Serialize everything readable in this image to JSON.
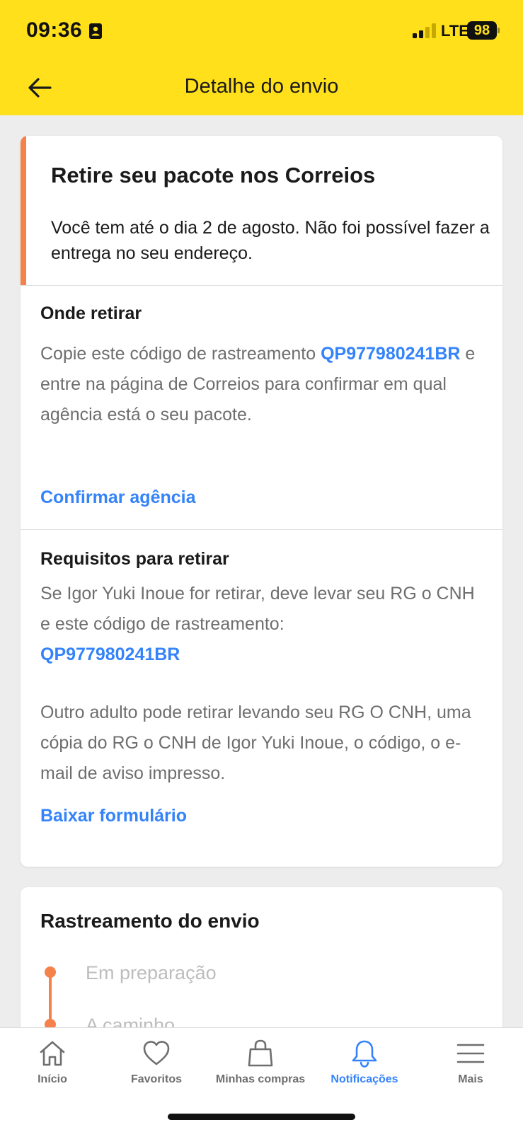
{
  "status_bar": {
    "time": "09:36",
    "network": "LTE",
    "battery": "98"
  },
  "header": {
    "title": "Detalhe do envio",
    "back_icon": "arrow-left-icon",
    "background": "#ffe01b"
  },
  "alert": {
    "title": "Retire seu pacote nos Correios",
    "text": "Você tem até o dia 2 de agosto. Não foi possível fazer a entrega no seu endereço.",
    "accent_color": "#f5824a"
  },
  "pickup_location": {
    "title": "Onde retirar",
    "text_before": "Copie este código de rastreamento ",
    "tracking_code": "QP977980241BR",
    "text_after": " e entre na página de Correios para confirmar em qual agência está o seu pacote.",
    "link": "Confirmar agência"
  },
  "requirements": {
    "title": "Requisitos para retirar",
    "text1": "Se Igor Yuki Inoue for retirar, deve levar seu RG o CNH e este código de rastreamento:",
    "tracking_code": "QP977980241BR",
    "text2": "Outro adulto pode retirar levando seu RG O CNH, uma cópia do RG o CNH de Igor Yuki Inoue, o código, o e-mail de aviso impresso.",
    "link": "Baixar formulário"
  },
  "tracking": {
    "title": "Rastreamento do envio",
    "steps": [
      "Em preparação",
      "A caminho"
    ]
  },
  "bottom_nav": {
    "items": [
      {
        "label": "Início",
        "icon": "home-icon"
      },
      {
        "label": "Favoritos",
        "icon": "heart-icon"
      },
      {
        "label": "Minhas compras",
        "icon": "shopping-bag-icon"
      },
      {
        "label": "Notificações",
        "icon": "bell-icon",
        "active": true
      },
      {
        "label": "Mais",
        "icon": "menu-icon"
      }
    ],
    "active_color": "#3483fa"
  }
}
